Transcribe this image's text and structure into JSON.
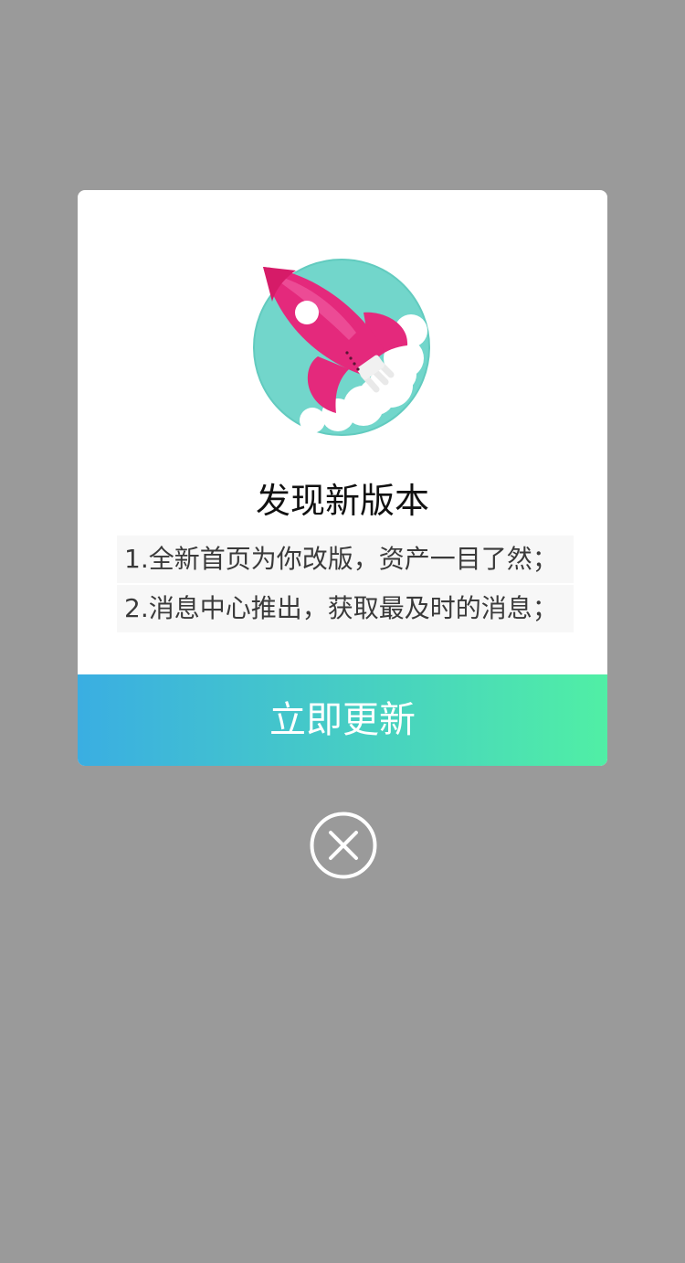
{
  "dialog": {
    "title": "发现新版本",
    "notes": [
      "1.全新首页为你改版，资产一目了然；",
      "2.消息中心推出，获取最及时的消息；"
    ],
    "update_button_label": "立即更新",
    "illustration_icon": "rocket-icon",
    "close_icon": "close-circle-icon"
  },
  "colors": {
    "overlay": "#9a9a9a",
    "dialog_bg": "#ffffff",
    "button_gradient_start": "#3aaee2",
    "button_gradient_end": "#50efa5",
    "rocket_body": "#e4297c",
    "circle_bg": "#72d6cb"
  }
}
